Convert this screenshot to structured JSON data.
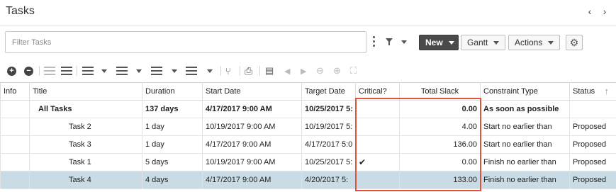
{
  "window": {
    "title": "Tasks",
    "nav_prev": "‹",
    "nav_next": "›"
  },
  "filter": {
    "placeholder": "Filter Tasks",
    "value": ""
  },
  "header_buttons": {
    "new_label": "New",
    "gantt_label": "Gantt",
    "actions_label": "Actions",
    "settings_icon": "gear-icon"
  },
  "toolbar_icons": [
    "add-icon",
    "remove-icon",
    "outdent-icon",
    "indent-icon",
    "insert-above-icon",
    "insert-below-icon",
    "move-up-icon",
    "move-down-icon",
    "link-icon",
    "print-icon",
    "properties-icon",
    "nav-back-icon",
    "nav-forward-icon",
    "zoom-out-icon",
    "zoom-in-icon",
    "zoom-fit-icon"
  ],
  "table": {
    "columns": [
      "Info",
      "Title",
      "Duration",
      "Start Date",
      "Target Date",
      "Critical?",
      "Total Slack",
      "Constraint Type",
      "Status"
    ],
    "rows": [
      {
        "info": "",
        "title": "All Tasks",
        "duration": "137 days",
        "start": "4/17/2017 9:00 AM",
        "target": "10/25/2017 5:",
        "critical": "",
        "slack": "0.00",
        "constraint": "As soon as possible",
        "status": ""
      },
      {
        "info": "",
        "title": "Task 2",
        "duration": "1 day",
        "start": "10/19/2017 9:00 AM",
        "target": "10/19/2017 5:",
        "critical": "",
        "slack": "4.00",
        "constraint": "Start no earlier than",
        "status": "Proposed"
      },
      {
        "info": "",
        "title": "Task 3",
        "duration": "1 day",
        "start": "4/17/2017 9:00 AM",
        "target": "4/17/2017 5:0",
        "critical": "",
        "slack": "136.00",
        "constraint": "Start no earlier than",
        "status": "Proposed"
      },
      {
        "info": "",
        "title": "Task 1",
        "duration": "5 days",
        "start": "10/19/2017 9:00 AM",
        "target": "10/25/2017 5:",
        "critical": "✔",
        "slack": "0.00",
        "constraint": "Finish no earlier than",
        "status": "Proposed"
      },
      {
        "info": "",
        "title": "Task 4",
        "duration": "4 days",
        "start": "4/17/2017 9:00 AM",
        "target": "4/20/2017 5:",
        "critical": "",
        "slack": "133.00",
        "constraint": "Finish no earlier than",
        "status": "Proposed"
      }
    ]
  },
  "colors": {
    "highlight_border": "#e0533a",
    "selected_row": "#c9dbe4",
    "new_button": "#4a4a4a"
  }
}
